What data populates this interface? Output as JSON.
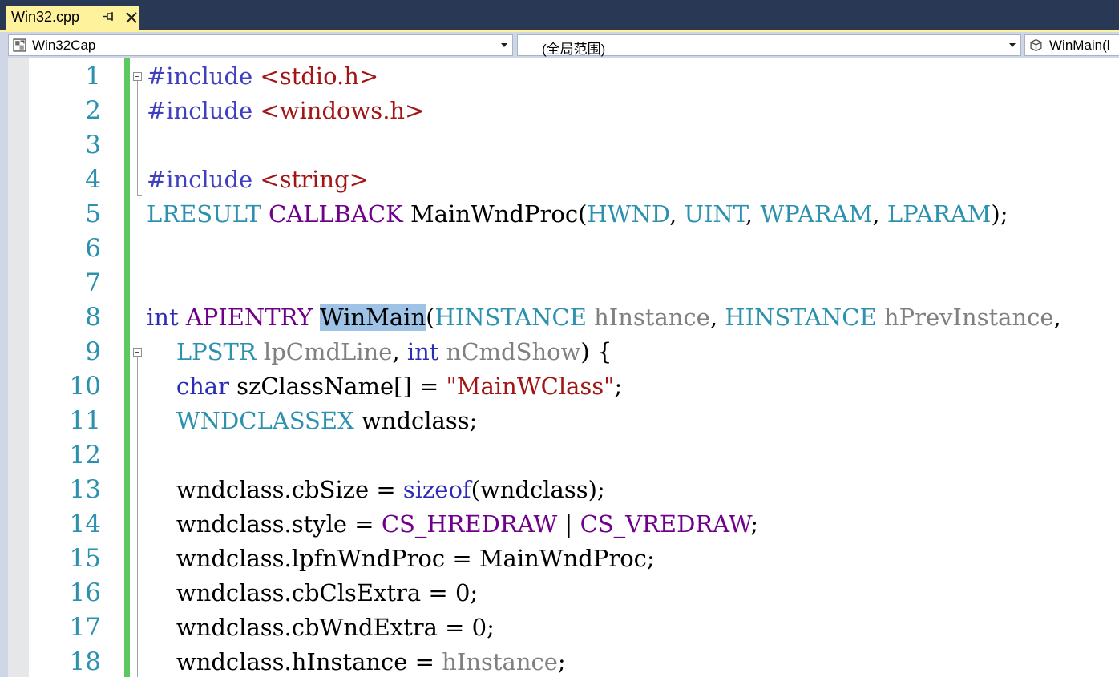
{
  "tab": {
    "title": "Win32.cpp",
    "pin_icon": "pin-icon",
    "close_icon": "close-icon"
  },
  "nav": {
    "project": "Win32Cap",
    "scope": "(全局范围)",
    "member": "WinMain(l"
  },
  "colors": {
    "tab_accent": "#fff29d",
    "chrome": "#293955",
    "change_bar": "#5cc85f",
    "line_number": "#2b91af",
    "keyword": "#0000ff",
    "string": "#a31515",
    "type": "#2b91af",
    "macro": "#6f008a",
    "parameter": "#808080",
    "highlight": "#9ec3e6"
  },
  "line_numbers": [
    "1",
    "2",
    "3",
    "4",
    "5",
    "6",
    "7",
    "8",
    "9",
    "10",
    "11",
    "12",
    "13",
    "14",
    "15",
    "16",
    "17",
    "18"
  ],
  "code_lines": [
    [
      {
        "t": "#include ",
        "c": "pp"
      },
      {
        "t": "<stdio.h>",
        "c": "incl"
      }
    ],
    [
      {
        "t": "#include ",
        "c": "pp"
      },
      {
        "t": "<windows.h>",
        "c": "incl"
      }
    ],
    [],
    [
      {
        "t": "#include ",
        "c": "pp"
      },
      {
        "t": "<string>",
        "c": "incl"
      }
    ],
    [
      {
        "t": "LRESULT",
        "c": "typ"
      },
      {
        "t": " "
      },
      {
        "t": "CALLBACK",
        "c": "macro"
      },
      {
        "t": " MainWndProc("
      },
      {
        "t": "HWND",
        "c": "typ"
      },
      {
        "t": ", "
      },
      {
        "t": "UINT",
        "c": "typ"
      },
      {
        "t": ", "
      },
      {
        "t": "WPARAM",
        "c": "typ"
      },
      {
        "t": ", "
      },
      {
        "t": "LPARAM",
        "c": "typ"
      },
      {
        "t": ");"
      }
    ],
    [],
    [],
    [
      {
        "t": "int",
        "c": "kw"
      },
      {
        "t": " "
      },
      {
        "t": "APIENTRY",
        "c": "macro"
      },
      {
        "t": " "
      },
      {
        "t": "WinMain",
        "c": "hl"
      },
      {
        "t": "("
      },
      {
        "t": "HINSTANCE",
        "c": "typ"
      },
      {
        "t": " "
      },
      {
        "t": "hInstance",
        "c": "param"
      },
      {
        "t": ", "
      },
      {
        "t": "HINSTANCE",
        "c": "typ"
      },
      {
        "t": " "
      },
      {
        "t": "hPrevInstance",
        "c": "param"
      },
      {
        "t": ","
      }
    ],
    [
      {
        "t": "    "
      },
      {
        "t": "LPSTR",
        "c": "typ"
      },
      {
        "t": " "
      },
      {
        "t": "lpCmdLine",
        "c": "param"
      },
      {
        "t": ", "
      },
      {
        "t": "int",
        "c": "kw"
      },
      {
        "t": " "
      },
      {
        "t": "nCmdShow",
        "c": "param"
      },
      {
        "t": ") {"
      }
    ],
    [
      {
        "t": "    "
      },
      {
        "t": "char",
        "c": "kw"
      },
      {
        "t": " szClassName[] = "
      },
      {
        "t": "\"MainWClass\"",
        "c": "str"
      },
      {
        "t": ";"
      }
    ],
    [
      {
        "t": "    "
      },
      {
        "t": "WNDCLASSEX",
        "c": "typ"
      },
      {
        "t": " wndclass;"
      }
    ],
    [],
    [
      {
        "t": "    wndclass.cbSize = "
      },
      {
        "t": "sizeof",
        "c": "kw"
      },
      {
        "t": "(wndclass);"
      }
    ],
    [
      {
        "t": "    wndclass.style = "
      },
      {
        "t": "CS_HREDRAW",
        "c": "macro"
      },
      {
        "t": " | "
      },
      {
        "t": "CS_VREDRAW",
        "c": "macro"
      },
      {
        "t": ";"
      }
    ],
    [
      {
        "t": "    wndclass.lpfnWndProc = MainWndProc;"
      }
    ],
    [
      {
        "t": "    wndclass.cbClsExtra = 0;"
      }
    ],
    [
      {
        "t": "    wndclass.cbWndExtra = 0;"
      }
    ],
    [
      {
        "t": "    wndclass.hInstance = "
      },
      {
        "t": "hInstance",
        "c": "param"
      },
      {
        "t": ";"
      }
    ]
  ]
}
